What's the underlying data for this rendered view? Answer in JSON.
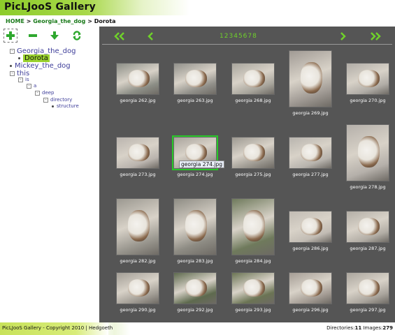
{
  "app": {
    "title": "PicLJooS Gallery"
  },
  "breadcrumb": {
    "home": "HOME",
    "sep1": " > ",
    "folder": "Georgia_the_dog",
    "sep2": " > ",
    "current": "Dorota"
  },
  "toolbar": {
    "add": "add-icon",
    "remove": "minus-icon",
    "down": "arrow-down-icon",
    "refresh": "refresh-icon"
  },
  "tree": [
    {
      "label": "Georgia_the_dog",
      "marker": "⊟",
      "depth": 0
    },
    {
      "label": "Dorota",
      "marker": "•",
      "depth": 1,
      "selected": true
    },
    {
      "label": "Mickey_the_dog",
      "marker": "•",
      "depth": 0
    },
    {
      "label": "this",
      "marker": "⊟",
      "depth": 0
    },
    {
      "label": "is",
      "marker": "⊟",
      "depth": 1
    },
    {
      "label": "a",
      "marker": "⊟",
      "depth": 2
    },
    {
      "label": "deep",
      "marker": "⊟",
      "depth": 3
    },
    {
      "label": "directory",
      "marker": "⊟",
      "depth": 4
    },
    {
      "label": "structure",
      "marker": "•",
      "depth": 5
    }
  ],
  "pager": {
    "first": "«",
    "prev": "‹",
    "next": "›",
    "last": "»",
    "pages": [
      "1",
      "2",
      "3",
      "4",
      "5",
      "6",
      "7",
      "8"
    ]
  },
  "images": [
    {
      "name": "georgia 262.jpg",
      "orient": "landscape",
      "tone": "#8c8e86"
    },
    {
      "name": "georgia 263.jpg",
      "orient": "landscape",
      "tone": "#91908a"
    },
    {
      "name": "georgia 268.jpg",
      "orient": "landscape",
      "tone": "#a8a59c"
    },
    {
      "name": "georgia 269.jpg",
      "orient": "portrait",
      "tone": "#a09a94"
    },
    {
      "name": "georgia 270.jpg",
      "orient": "landscape",
      "tone": "#b0aca6"
    },
    {
      "name": "georgia 273.jpg",
      "orient": "landscape",
      "tone": "#bab4ae"
    },
    {
      "name": "georgia 274.jpg",
      "orient": "landscape",
      "tone": "#a9a39c",
      "selected": true
    },
    {
      "name": "georgia 275.jpg",
      "orient": "landscape",
      "tone": "#9d9991"
    },
    {
      "name": "georgia 277.jpg",
      "orient": "landscape",
      "tone": "#b8b4ae"
    },
    {
      "name": "georgia 278.jpg",
      "orient": "portrait",
      "tone": "#b5b0aa"
    },
    {
      "name": "georgia 282.jpg",
      "orient": "portrait",
      "tone": "#9b9890"
    },
    {
      "name": "georgia 283.jpg",
      "orient": "portrait",
      "tone": "#8e8c84"
    },
    {
      "name": "georgia 284.jpg",
      "orient": "portrait",
      "tone": "#6f7a5c"
    },
    {
      "name": "georgia 286.jpg",
      "orient": "landscape",
      "tone": "#c2bcb4"
    },
    {
      "name": "georgia 287.jpg",
      "orient": "landscape",
      "tone": "#b3aea6"
    },
    {
      "name": "georgia 290.jpg",
      "orient": "landscape",
      "tone": "#a29d95"
    },
    {
      "name": "georgia 292.jpg",
      "orient": "landscape",
      "tone": "#5e6a4e"
    },
    {
      "name": "georgia 293.jpg",
      "orient": "landscape",
      "tone": "#6b7454"
    },
    {
      "name": "georgia 296.jpg",
      "orient": "landscape",
      "tone": "#a49c94"
    },
    {
      "name": "georgia 297.jpg",
      "orient": "landscape",
      "tone": "#aaa59d"
    }
  ],
  "tooltip": "georgia 274.jpg",
  "footer": {
    "copyright": "PicLJooS Gallery - Copyright 2010 | Hedgoeth",
    "dirs_label": "Directories:",
    "dirs_value": "11",
    "images_label": "Images:",
    "images_value": "279"
  },
  "colors": {
    "accent": "#6fd12a",
    "panel": "#555555",
    "title_gradient": "#8ccc2a"
  }
}
